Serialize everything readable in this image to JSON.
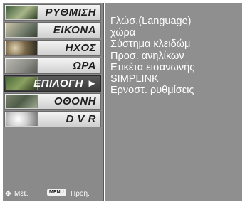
{
  "menu": {
    "items": [
      {
        "label": "ΡΥΘΜΙΣΗ",
        "selected": false
      },
      {
        "label": "ΕΙΚΟΝΑ",
        "selected": false
      },
      {
        "label": "ΗΧΟΣ",
        "selected": false
      },
      {
        "label": "ΩΡΑ",
        "selected": false
      },
      {
        "label": "ΕΠΙΛΟΓΗ ►",
        "selected": true
      },
      {
        "label": "ΟΘΟΝΗ",
        "selected": false
      },
      {
        "label": "D V R",
        "selected": false
      }
    ]
  },
  "submenu": {
    "items": [
      "Γλώσ.(Language)",
      "χώρα",
      "Σύστημα κλειδώμ",
      "Προσ. ανηλίκων",
      "Ετικέτα εισανωνής",
      "SIMPLINK",
      "Ερνοστ. ρυθμίσεις"
    ]
  },
  "footer": {
    "nav_label": "Μετ.",
    "menu_key": "MENU",
    "menu_label": "Προη."
  },
  "colors": {
    "panel_bg": "#8a8a8a",
    "selected_bg": "#444444",
    "item_bg": "#e6e6e6"
  }
}
